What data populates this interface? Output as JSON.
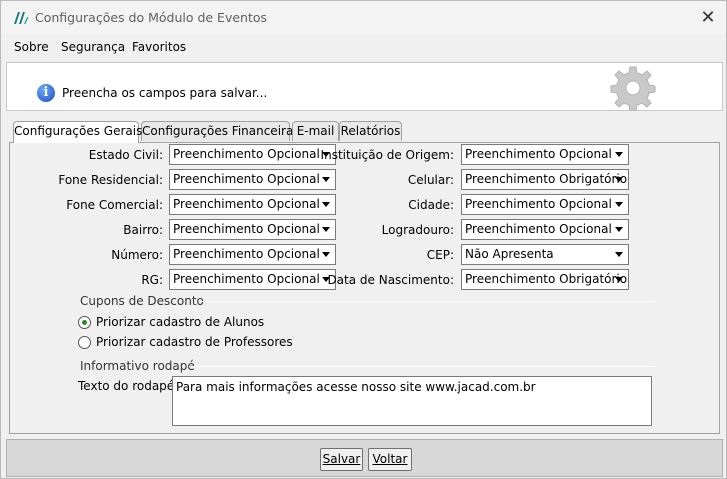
{
  "window": {
    "title": "Configurações do Módulo de Eventos",
    "close_glyph": "✕"
  },
  "menu": [
    {
      "label": "Sobre"
    },
    {
      "label": "Segurança"
    },
    {
      "label": "Favoritos"
    }
  ],
  "info": {
    "icon": "i",
    "message": "Preencha os campos para salvar..."
  },
  "tabs": [
    {
      "label": "Configurações Gerais",
      "active": true
    },
    {
      "label": "Configurações Financeiras",
      "active": false
    },
    {
      "label": "E-mail",
      "active": false
    },
    {
      "label": "Relatórios",
      "active": false
    }
  ],
  "fields_left": [
    {
      "label": "Estado Civil:",
      "value": "Preenchimento Opcional"
    },
    {
      "label": "Fone Residencial:",
      "value": "Preenchimento Opcional"
    },
    {
      "label": "Fone Comercial:",
      "value": "Preenchimento Opcional"
    },
    {
      "label": "Bairro:",
      "value": "Preenchimento Opcional"
    },
    {
      "label": "Número:",
      "value": "Preenchimento Opcional"
    },
    {
      "label": "RG:",
      "value": "Preenchimento Opcional"
    }
  ],
  "fields_right": [
    {
      "label": "Instituição de Origem:",
      "value": "Preenchimento Opcional"
    },
    {
      "label": "Celular:",
      "value": "Preenchimento Obrigatório"
    },
    {
      "label": "Cidade:",
      "value": "Preenchimento Opcional"
    },
    {
      "label": "Logradouro:",
      "value": "Preenchimento Opcional"
    },
    {
      "label": "CEP:",
      "value": "Não Apresenta"
    },
    {
      "label": "Data de Nascimento:",
      "value": "Preenchimento Obrigatório"
    }
  ],
  "coupons": {
    "title": "Cupons de Desconto",
    "options": [
      {
        "label": "Priorizar cadastro de Alunos",
        "checked": true
      },
      {
        "label": "Priorizar cadastro de Professores",
        "checked": false
      }
    ]
  },
  "footer_info": {
    "title": "Informativo rodapé",
    "label": "Texto do rodapé:",
    "value": "Para mais informações acesse nosso site www.jacad.com.br"
  },
  "buttons": {
    "save": "Salvar",
    "back": "Voltar"
  }
}
